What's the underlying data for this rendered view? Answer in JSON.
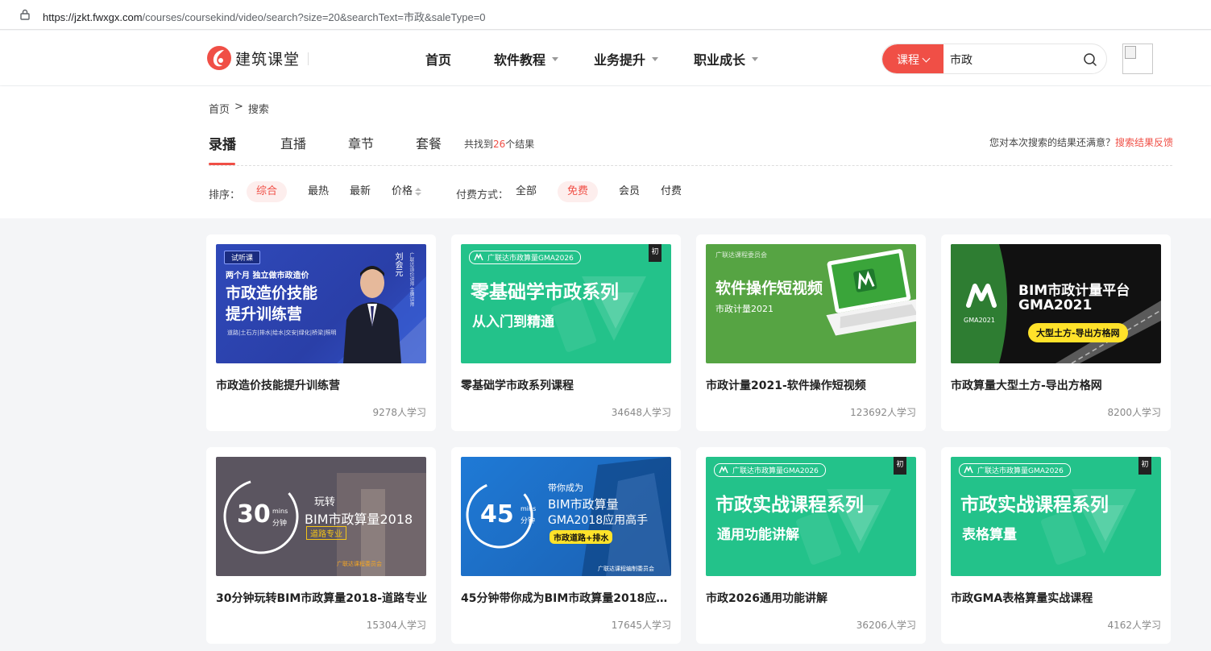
{
  "browser": {
    "url_host": "https://jzkt.fwxgx.com",
    "url_path": "/courses/coursekind/video/search?size=20&searchText=市政&saleType=0"
  },
  "header": {
    "logo_text": "建筑课堂",
    "nav": [
      "首页",
      "软件教程",
      "业务提升",
      "职业成长"
    ],
    "search": {
      "scope": "课程",
      "value": "市政"
    }
  },
  "breadcrumb": {
    "home": "首页",
    "sep": ">",
    "current": "搜索"
  },
  "tabs": [
    "录播",
    "直播",
    "章节",
    "套餐"
  ],
  "result": {
    "prefix": "共找到",
    "count": "26",
    "suffix": "个结果"
  },
  "feedback": {
    "question": "您对本次搜索的结果还满意？",
    "link": "搜索结果反馈"
  },
  "sort": {
    "label": "排序：",
    "options": [
      "综合",
      "最热",
      "最新",
      "价格"
    ],
    "selected": "综合"
  },
  "payment": {
    "label": "付费方式：",
    "options": [
      "全部",
      "免费",
      "会员",
      "付费"
    ],
    "selected": "免费"
  },
  "colors": {
    "accent": "#f04f46",
    "green": "#23c28a"
  },
  "courses": [
    {
      "title": "市政造价技能提升训练营",
      "learners": "9278",
      "unit": "人学习",
      "thumb": {
        "tag": "试听课",
        "line1": "两个月 独立做市政造价",
        "line2": "市政造价技能",
        "line3": "提升训练营",
        "line4": "道路|土石方|排水|给水|交安|绿化|桥梁|照明",
        "teacher": "刘会元",
        "side": "广联达造价讲师 金牌讲师"
      }
    },
    {
      "title": "零基础学市政系列课程",
      "learners": "34648",
      "unit": "人学习",
      "thumb": {
        "chip": "广联达市政算量GMA2026",
        "level": "初",
        "line1": "零基础学市政系列",
        "line2": "从入门到精通"
      }
    },
    {
      "title": "市政计量2021-软件操作短视频",
      "learners": "123692",
      "unit": "人学习",
      "thumb": {
        "chip": "广联达课程委员会",
        "line1": "软件操作短视频",
        "line2": "市政计量2021"
      }
    },
    {
      "title": "市政算量大型土方-导出方格网",
      "learners": "8200",
      "unit": "人学习",
      "thumb": {
        "line1": "BIM市政计量平台",
        "line2": "GMA2021",
        "logo_label": "GMA2021",
        "pill": "大型土方-导出方格网"
      }
    },
    {
      "title": "30分钟玩转BIM市政算量2018-道路专业",
      "learners": "15304",
      "unit": "人学习",
      "thumb": {
        "num": "30",
        "mins": "mins",
        "fen": "分钟",
        "line1": "玩转",
        "line2": "BIM市政算量2018",
        "pill": "道路专业",
        "footer": "广联达课程委员会"
      }
    },
    {
      "title": "45分钟带你成为BIM市政算量2018应用高手",
      "learners": "17645",
      "unit": "人学习",
      "thumb": {
        "num": "45",
        "mins": "mins",
        "fen": "分钟",
        "line0": "带你成为",
        "line1": "BIM市政算量",
        "line2": "GMA2018应用高手",
        "pill": "市政道路+排水",
        "footer": "广联达课程编制委员会"
      }
    },
    {
      "title": "市政2026通用功能讲解",
      "learners": "36206",
      "unit": "人学习",
      "thumb": {
        "chip": "广联达市政算量GMA2026",
        "level": "初",
        "line1": "市政实战课程系列",
        "line2": "通用功能讲解"
      }
    },
    {
      "title": "市政GMA表格算量实战课程",
      "learners": "4162",
      "unit": "人学习",
      "thumb": {
        "chip": "广联达市政算量GMA2026",
        "level": "初",
        "line1": "市政实战课程系列",
        "line2": "表格算量"
      }
    }
  ]
}
